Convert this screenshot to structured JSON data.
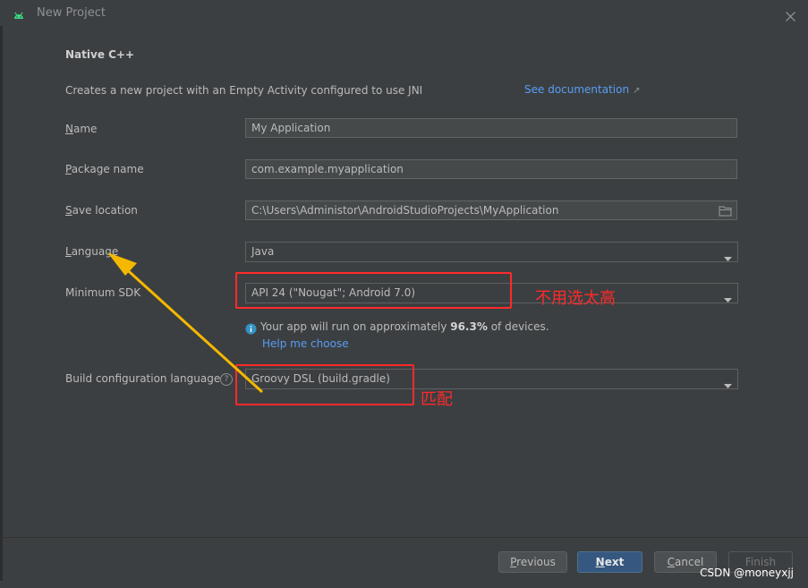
{
  "window": {
    "title": "New Project"
  },
  "template": {
    "name": "Native C++",
    "description": "Creates a new project with an Empty Activity configured to use JNI",
    "doc_link": "See documentation"
  },
  "form": {
    "name": {
      "label_mnemonic": "N",
      "label_rest": "ame",
      "value": "My Application"
    },
    "package": {
      "label_mnemonic": "P",
      "label_rest": "ackage name",
      "value": "com.example.myapplication"
    },
    "save_location": {
      "label_mnemonic": "S",
      "label_rest": "ave location",
      "value": "C:\\Users\\Administor\\AndroidStudioProjects\\MyApplication"
    },
    "language": {
      "label_mnemonic": "L",
      "label_rest": "anguage",
      "value": "Java"
    },
    "min_sdk": {
      "label": "Minimum SDK",
      "value": "API 24 (\"Nougat\"; Android 7.0)"
    },
    "sdk_info": {
      "prefix": "Your app will run on approximately ",
      "percent": "96.3%",
      "suffix": " of devices."
    },
    "help_link": "Help me choose",
    "build_config": {
      "label": "Build configuration language",
      "value": "Groovy DSL (build.gradle)",
      "help_glyph": "?"
    }
  },
  "buttons": {
    "previous": {
      "mnemonic": "P",
      "rest": "revious"
    },
    "next": {
      "mnemonic": "N",
      "rest": "ext"
    },
    "cancel": {
      "mnemonic": "C",
      "rest": "ancel"
    },
    "finish": {
      "label": "Finish"
    }
  },
  "annotations": {
    "sdk_note": "不用选太高",
    "build_note": "匹配",
    "color": "#ff2a2a"
  },
  "watermark": "CSDN @moneyxjj",
  "colors": {
    "link": "#589df6",
    "primary_button": "#365880",
    "background": "#3c3f41"
  }
}
